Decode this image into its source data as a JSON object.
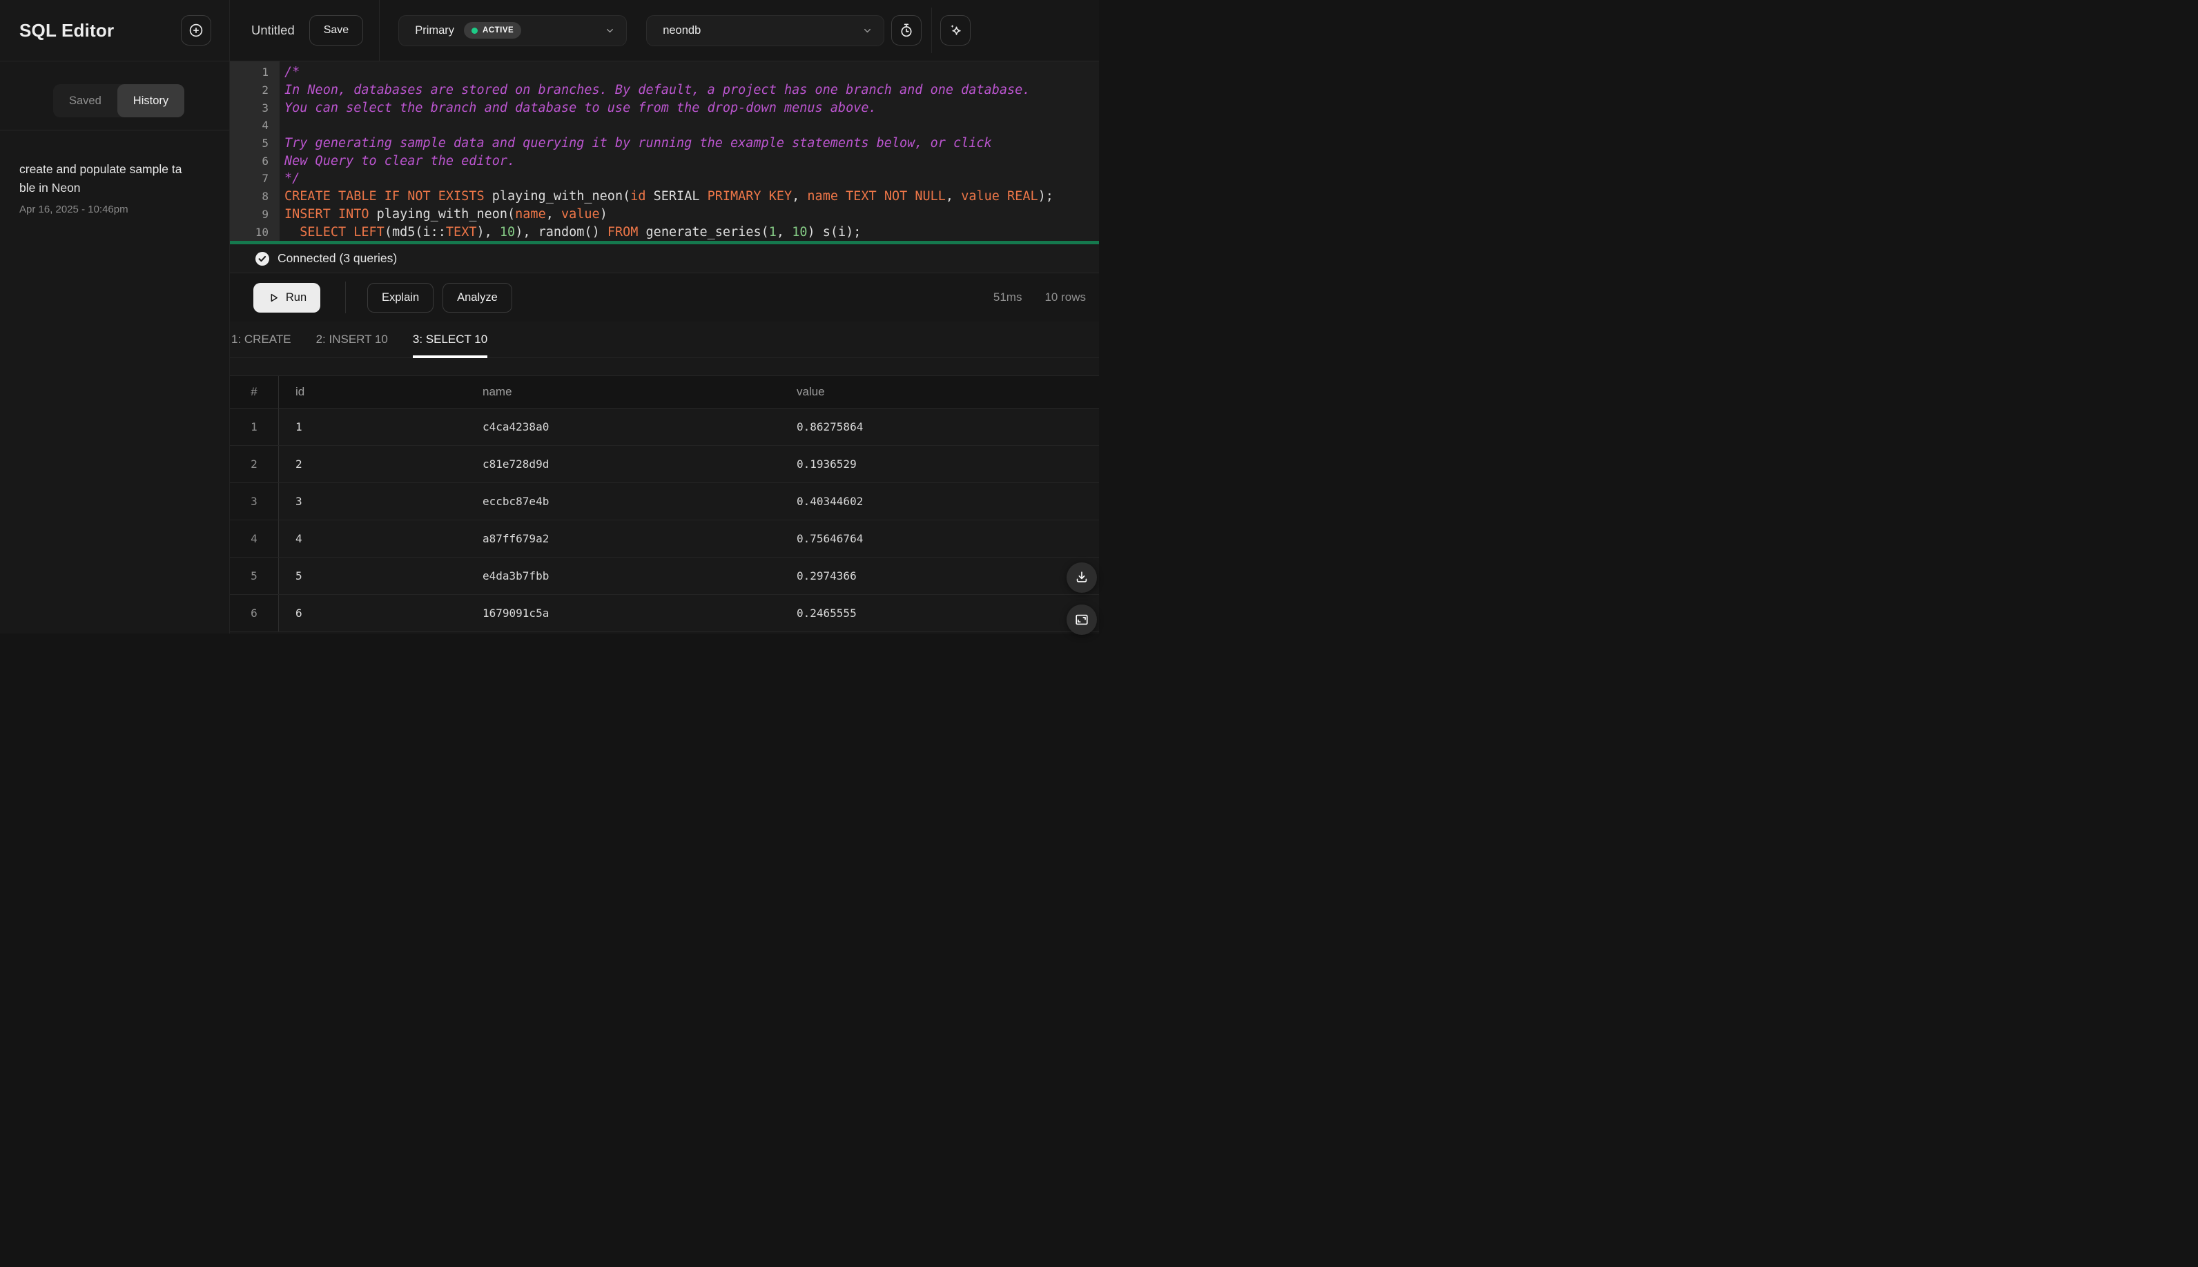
{
  "app": {
    "title": "SQL Editor"
  },
  "colors": {
    "accent_green": "#15794e",
    "status_dot_green": "#1ecb87",
    "keyword_orange": "#ed7648",
    "comment_purple": "#bb55cf",
    "number_green": "#85cb85",
    "run_button_bg": "#ececec"
  },
  "sidebar": {
    "tabs": [
      {
        "label": "Saved",
        "active": false
      },
      {
        "label": "History",
        "active": true
      }
    ],
    "history_item": {
      "title_lines": [
        "create and populate sample ta",
        "ble in Neon"
      ],
      "date": "Apr 16, 2025 - 10:46pm"
    }
  },
  "topbar": {
    "query_name": "Untitled",
    "save_label": "Save",
    "branch": {
      "name": "Primary",
      "status": "ACTIVE"
    },
    "database": {
      "name": "neondb"
    }
  },
  "editor": {
    "lines": [
      {
        "no": 1,
        "tokens": [
          [
            "c",
            "/*"
          ]
        ]
      },
      {
        "no": 2,
        "tokens": [
          [
            "c",
            "In Neon, databases are stored on branches. By default, a project has one branch and one database."
          ]
        ]
      },
      {
        "no": 3,
        "tokens": [
          [
            "c",
            "You can select the branch and database to use from the drop-down menus above."
          ]
        ]
      },
      {
        "no": 4,
        "tokens": []
      },
      {
        "no": 5,
        "tokens": [
          [
            "c",
            "Try generating sample data and querying it by running the example statements below, or click"
          ]
        ]
      },
      {
        "no": 6,
        "tokens": [
          [
            "c",
            "New Query to clear the editor."
          ]
        ]
      },
      {
        "no": 7,
        "tokens": [
          [
            "c",
            "*/"
          ]
        ]
      },
      {
        "no": 8,
        "tokens": [
          [
            "k",
            "CREATE TABLE IF NOT EXISTS"
          ],
          [
            "p",
            " playing_with_neon("
          ],
          [
            "k",
            "id"
          ],
          [
            "p",
            " SERIAL "
          ],
          [
            "k",
            "PRIMARY KEY"
          ],
          [
            "p",
            ", "
          ],
          [
            "k",
            "name"
          ],
          [
            "p",
            " "
          ],
          [
            "k",
            "TEXT NOT NULL"
          ],
          [
            "p",
            ", "
          ],
          [
            "k",
            "value"
          ],
          [
            "p",
            " "
          ],
          [
            "k",
            "REAL"
          ],
          [
            "p",
            ");"
          ]
        ]
      },
      {
        "no": 9,
        "tokens": [
          [
            "k",
            "INSERT INTO"
          ],
          [
            "p",
            " playing_with_neon("
          ],
          [
            "k",
            "name"
          ],
          [
            "p",
            ", "
          ],
          [
            "k",
            "value"
          ],
          [
            "p",
            ")"
          ]
        ]
      },
      {
        "no": 10,
        "tokens": [
          [
            "p",
            "  "
          ],
          [
            "k",
            "SELECT"
          ],
          [
            "p",
            " "
          ],
          [
            "k",
            "LEFT"
          ],
          [
            "p",
            "(md5(i::"
          ],
          [
            "k",
            "TEXT"
          ],
          [
            "p",
            "), "
          ],
          [
            "n",
            "10"
          ],
          [
            "p",
            "), random() "
          ],
          [
            "k",
            "FROM"
          ],
          [
            "p",
            " generate_series("
          ],
          [
            "n",
            "1"
          ],
          [
            "p",
            ", "
          ],
          [
            "n",
            "10"
          ],
          [
            "p",
            ") s(i);"
          ]
        ]
      }
    ]
  },
  "status": {
    "connected": "Connected (3 queries)"
  },
  "actions": {
    "run": "Run",
    "explain": "Explain",
    "analyze": "Analyze",
    "duration": "51ms",
    "row_count": "10 rows"
  },
  "results": {
    "tabs": [
      {
        "label": "1: CREATE",
        "active": false
      },
      {
        "label": "2: INSERT 10",
        "active": false
      },
      {
        "label": "3: SELECT 10",
        "active": true
      }
    ],
    "table": {
      "headers": [
        "#",
        "id",
        "name",
        "value"
      ],
      "rows": [
        [
          "1",
          "1",
          "c4ca4238a0",
          "0.86275864"
        ],
        [
          "2",
          "2",
          "c81e728d9d",
          "0.1936529"
        ],
        [
          "3",
          "3",
          "eccbc87e4b",
          "0.40344602"
        ],
        [
          "4",
          "4",
          "a87ff679a2",
          "0.75646764"
        ],
        [
          "5",
          "5",
          "e4da3b7fbb",
          "0.2974366"
        ],
        [
          "6",
          "6",
          "1679091c5a",
          "0.2465555"
        ]
      ]
    }
  }
}
